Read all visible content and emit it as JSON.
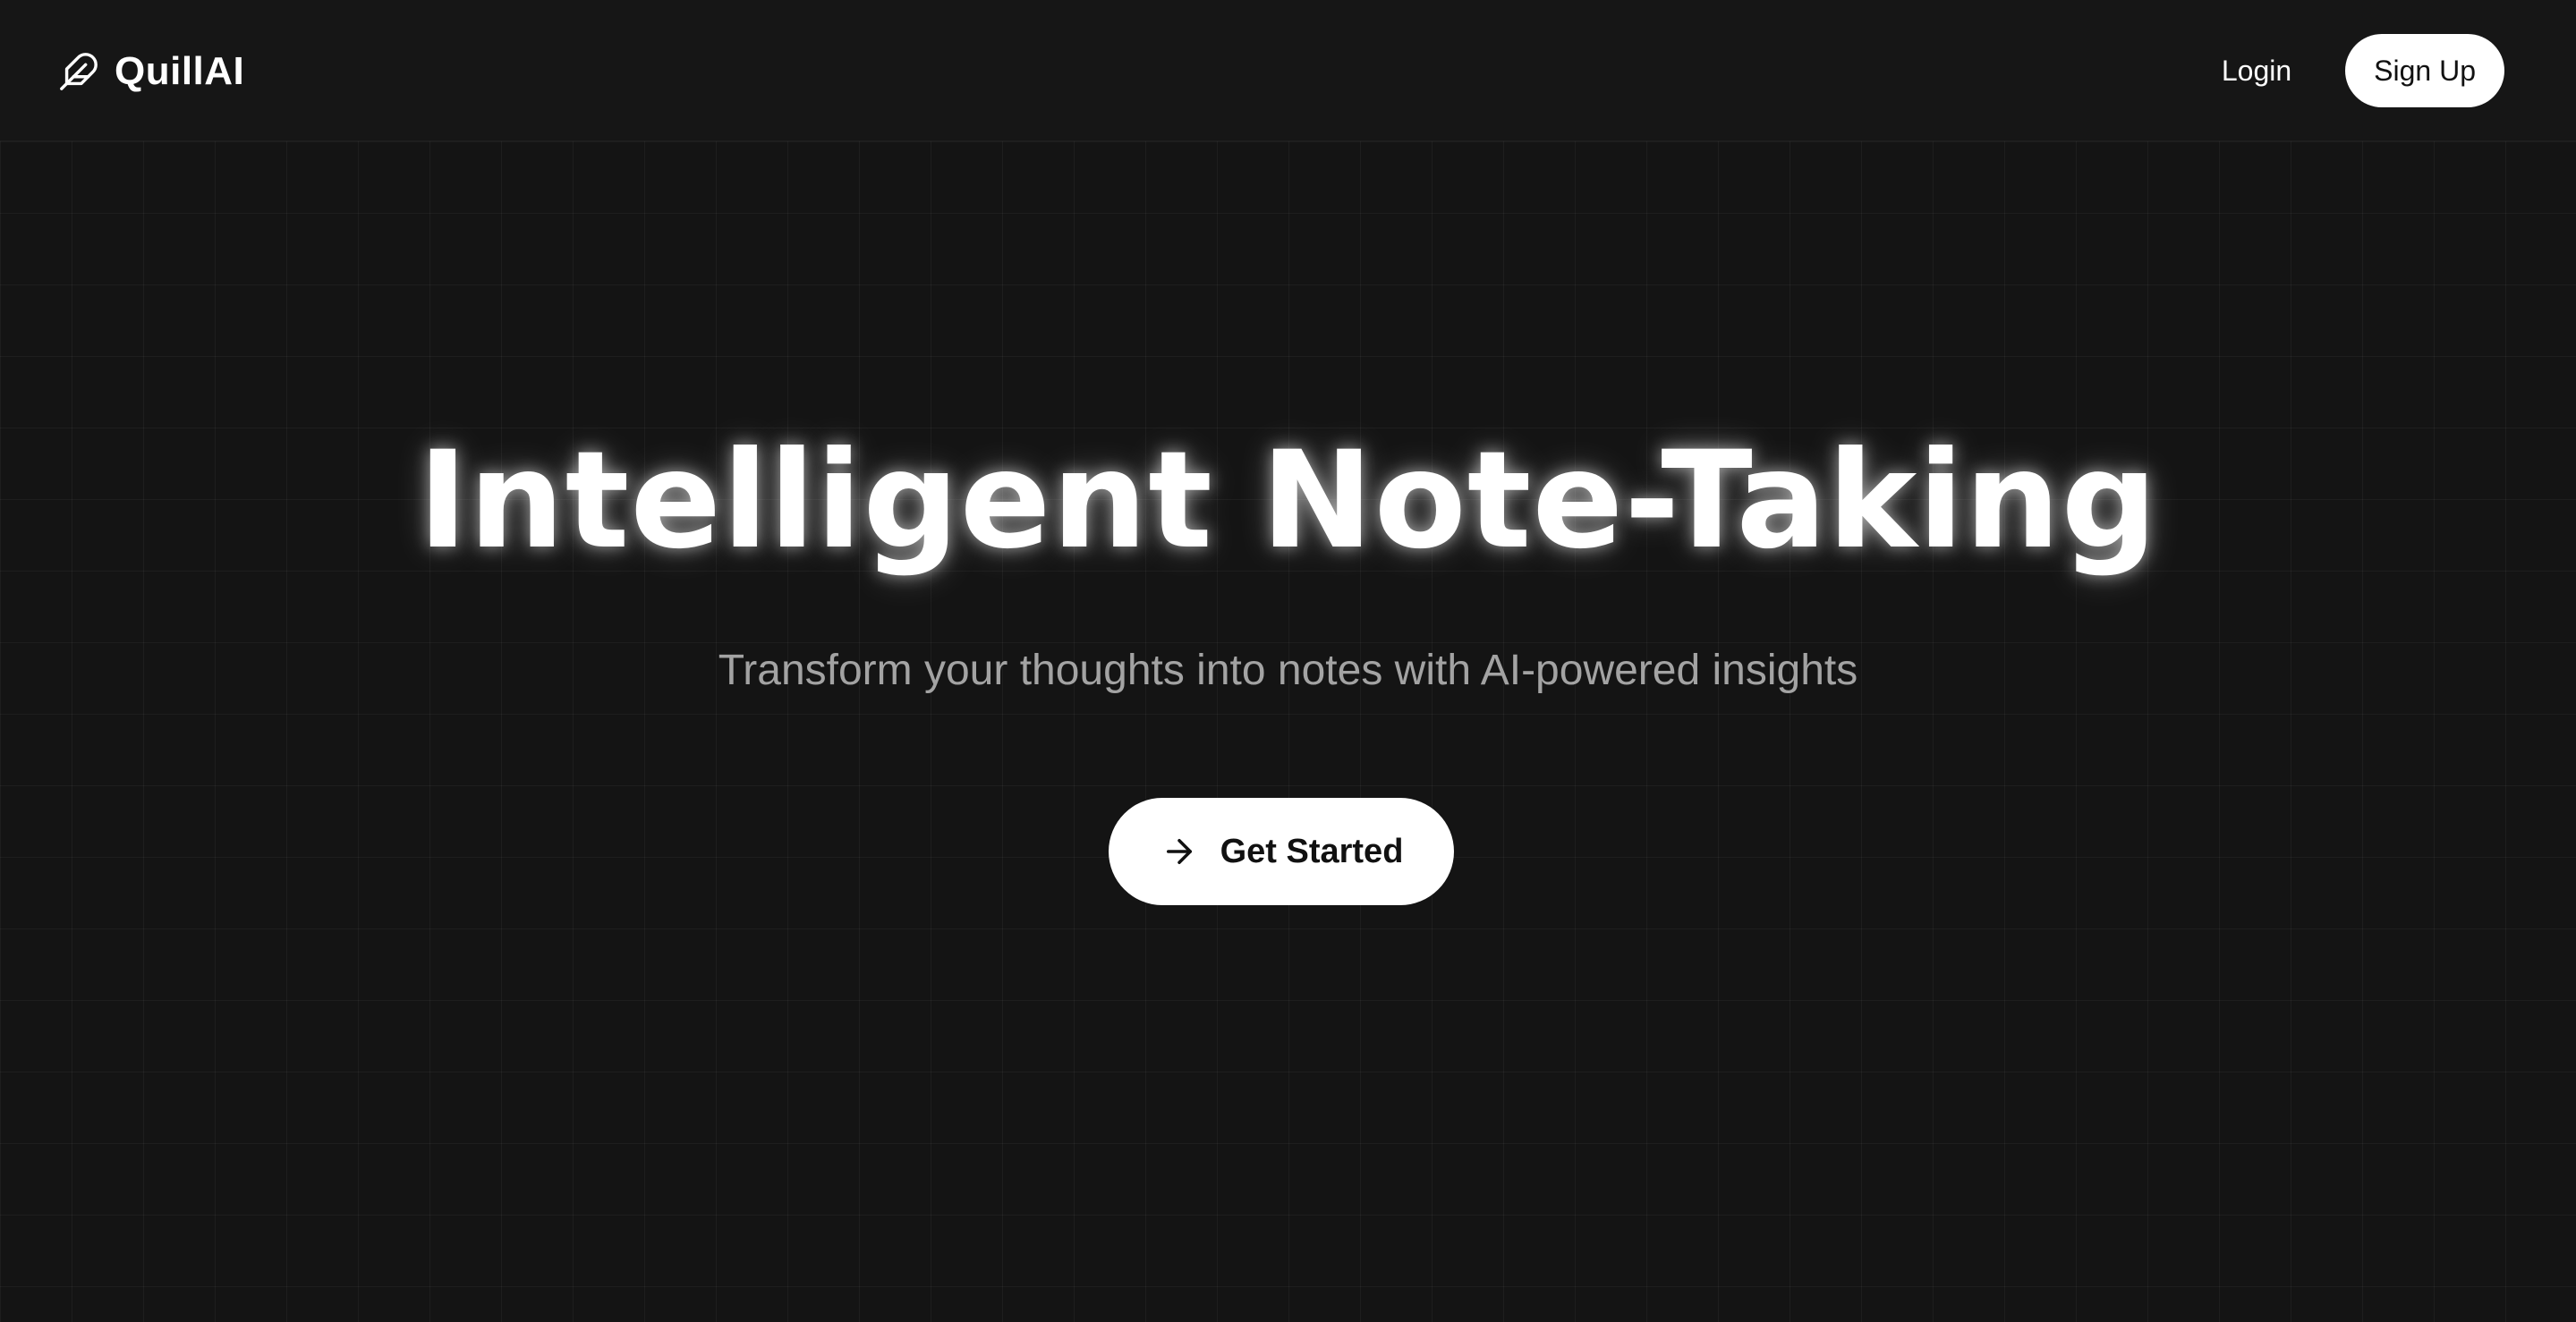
{
  "header": {
    "brand": {
      "name": "QuillAI",
      "icon": "feather-icon"
    },
    "nav": {
      "login_label": "Login",
      "signup_label": "Sign Up"
    }
  },
  "hero": {
    "title": "Intelligent Note-Taking",
    "subtitle": "Transform your thoughts into notes with AI-powered insights",
    "cta": {
      "label": "Get Started",
      "icon": "arrow-right-icon"
    }
  },
  "colors": {
    "background": "#141414",
    "primary_text": "#ffffff",
    "muted_text": "#a3a3a3",
    "button_bg": "#ffffff",
    "button_text": "#111111"
  }
}
